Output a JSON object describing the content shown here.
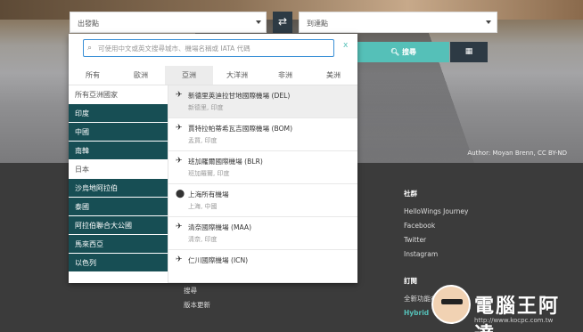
{
  "search": {
    "from_placeholder": "出發點",
    "to_placeholder": "到達點",
    "search_label": "搜尋",
    "swap_icon": "swap-icon",
    "calendar_icon": "calendar-icon"
  },
  "dropdown": {
    "input_placeholder": "可使用中文或英文搜尋城市、機場名稱或 IATA 代碼",
    "close_label": "x",
    "tabs": [
      "所有",
      "歐洲",
      "亞洲",
      "大洋洲",
      "非洲",
      "美洲"
    ],
    "active_tab": "亞洲",
    "countries": [
      {
        "label": "所有亞洲國家",
        "style": "light"
      },
      {
        "label": "印度",
        "style": "dark"
      },
      {
        "label": "中國",
        "style": "dark"
      },
      {
        "label": "南韓",
        "style": "dark"
      },
      {
        "label": "日本",
        "style": "light"
      },
      {
        "label": "沙烏地阿拉伯",
        "style": "dark"
      },
      {
        "label": "泰國",
        "style": "dark"
      },
      {
        "label": "阿拉伯聯合大公國",
        "style": "dark"
      },
      {
        "label": "馬來西亞",
        "style": "dark"
      },
      {
        "label": "以色列",
        "style": "dark"
      }
    ],
    "airports": [
      {
        "name": "新德里英迪拉甘地國際機場 (DEL)",
        "sub": "新德里, 印度",
        "icon": "plane-icon"
      },
      {
        "name": "賈特拉帕蒂希瓦吉國際機場 (BOM)",
        "sub": "孟買, 印度",
        "icon": "plane-icon"
      },
      {
        "name": "班加羅爾國際機場 (BLR)",
        "sub": "班加羅爾, 印度",
        "icon": "plane-icon"
      },
      {
        "name": "上海所有機場",
        "sub": "上海, 中國",
        "icon": "location-pin-icon"
      },
      {
        "name": "清奈國際機場 (MAA)",
        "sub": "清奈, 印度",
        "icon": "plane-icon"
      },
      {
        "name": "仁川國際機場 (ICN)",
        "sub": "",
        "icon": "plane-icon"
      }
    ]
  },
  "hero": {
    "credit": "Author: Moyan Brenn, CC BY-ND"
  },
  "footer": {
    "social_heading": "社群",
    "social_links": [
      "HelloWings Journey",
      "Facebook",
      "Twitter",
      "Instagram"
    ],
    "subscribe_heading": "訂閱",
    "subscribe_text": "全新功能在",
    "subscribe_hybrid": "Hybrid",
    "links": [
      "搜尋",
      "版本更新"
    ]
  },
  "watermark": {
    "text": "電腦王阿達",
    "url": "http://www.kocpc.com.tw"
  },
  "colors": {
    "accent": "#55c0b8",
    "dark_teal": "#174e54",
    "nav_dark": "#2d3a44",
    "footer_bg": "#3b3b3b"
  }
}
